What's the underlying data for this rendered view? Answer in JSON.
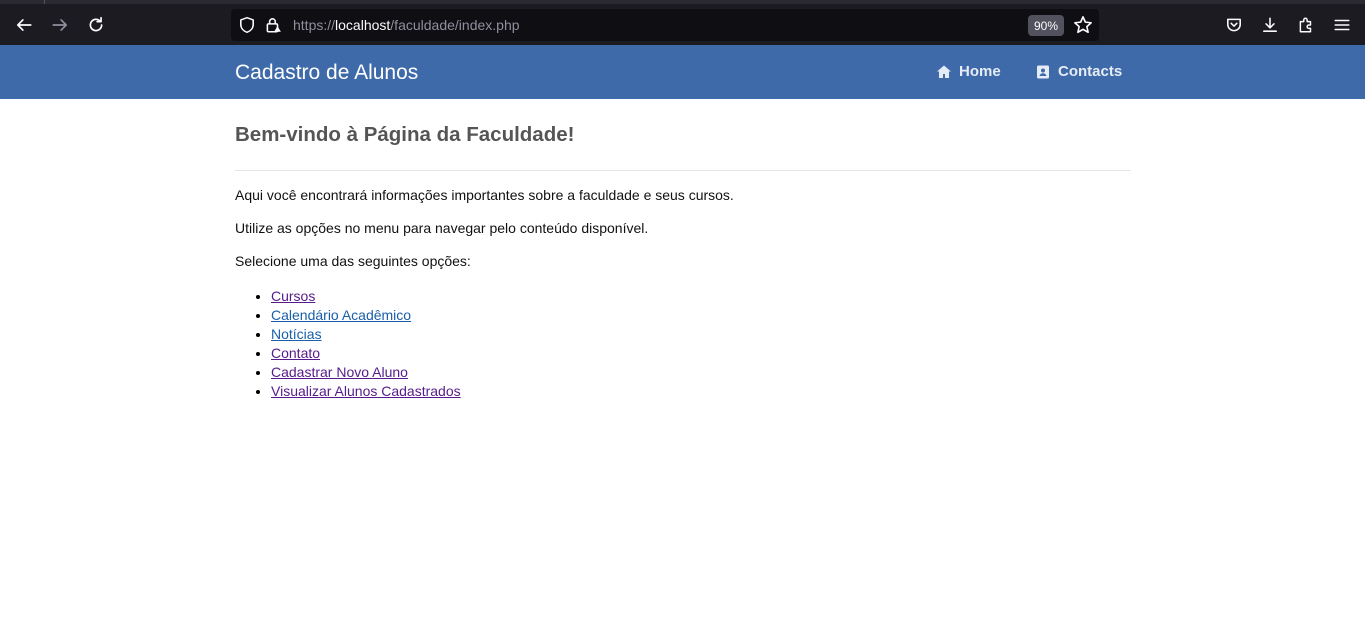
{
  "browser": {
    "url_scheme": "https://",
    "url_host": "localhost",
    "url_path": "/faculdade/index.php",
    "zoom": "90%",
    "icons": [
      "back-icon",
      "forward-icon",
      "reload-icon",
      "shield-icon",
      "lock-icon",
      "star-icon",
      "pocket-icon",
      "download-icon",
      "extensions-icon",
      "menu-icon"
    ]
  },
  "navbar": {
    "brand": "Cadastro de Alunos",
    "links": [
      {
        "label": "Home",
        "icon": "home-icon"
      },
      {
        "label": "Contacts",
        "icon": "contact-card-icon"
      }
    ],
    "color": "#3f6aa9"
  },
  "main": {
    "title": "Bem-vindo à Página da Faculdade!",
    "paragraphs": [
      "Aqui você encontrará informações importantes sobre a faculdade e seus cursos.",
      "Utilize as opções no menu para navegar pelo conteúdo disponível.",
      "Selecione uma das seguintes opções:"
    ],
    "options": [
      {
        "label": "Cursos",
        "visited": true
      },
      {
        "label": "Calendário Acadêmico",
        "visited": false
      },
      {
        "label": "Notícias",
        "visited": false
      },
      {
        "label": "Contato",
        "visited": true
      },
      {
        "label": "Cadastrar Novo Aluno",
        "visited": true
      },
      {
        "label": "Visualizar Alunos Cadastrados",
        "visited": true
      }
    ]
  }
}
